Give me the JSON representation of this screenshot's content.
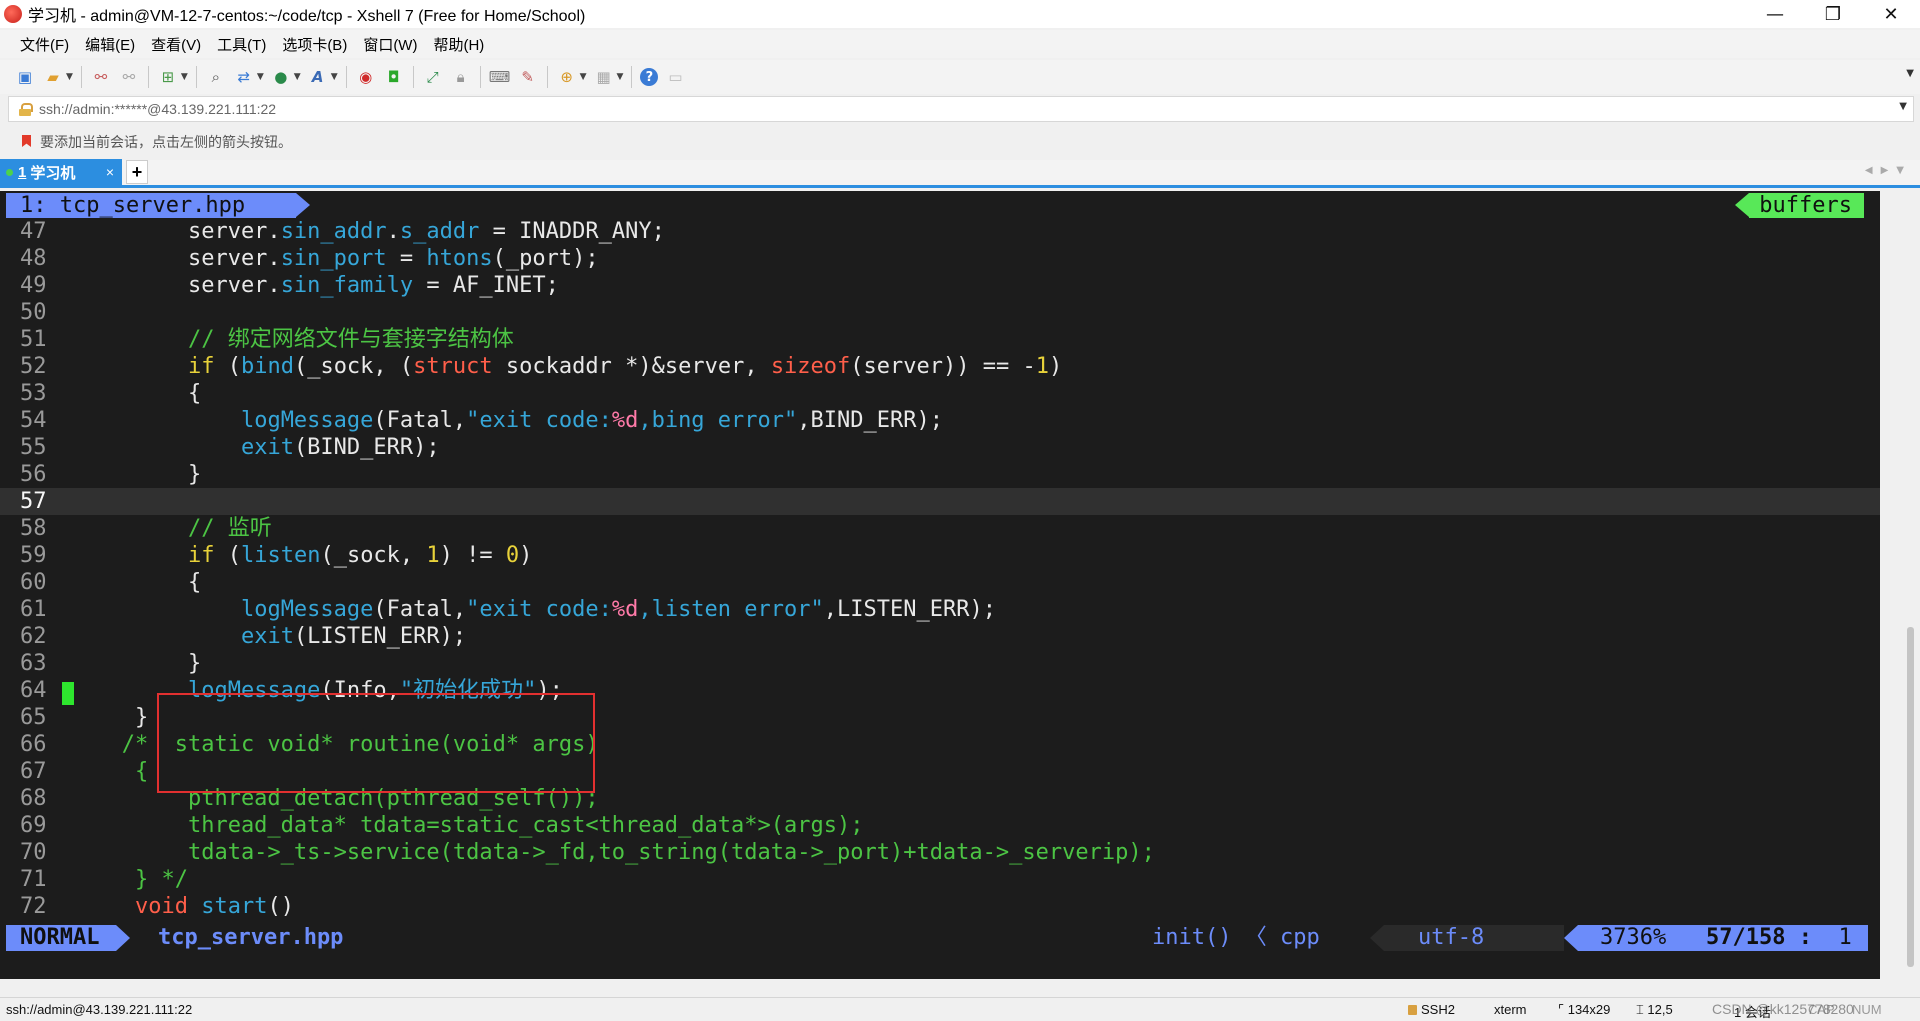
{
  "window": {
    "title": "学习机 - admin@VM-12-7-centos:~/code/tcp - Xshell 7 (Free for Home/School)",
    "minimize": "—",
    "restore": "❐",
    "close": "✕"
  },
  "menu": [
    "文件(F)",
    "编辑(E)",
    "查看(V)",
    "工具(T)",
    "选项卡(B)",
    "窗口(W)",
    "帮助(H)"
  ],
  "toolbar": {
    "icons": [
      "new-session-icon",
      "open-folder-icon",
      "disconnect-icon",
      "reconnect-icon",
      "new-tab-icon",
      "find-icon",
      "transfer-icon",
      "globe-icon",
      "font-icon",
      "xftp-icon",
      "xshell-icon",
      "fullscreen-icon",
      "lock-icon",
      "keyboard-icon",
      "script-icon",
      "compose-icon",
      "layout-icon",
      "help-icon",
      "chat-icon"
    ]
  },
  "address": {
    "value": "ssh://admin:******@43.139.221.111:22"
  },
  "hint": {
    "text": "要添加当前会话，点击左侧的箭头按钮。"
  },
  "tabs": [
    {
      "number": "1",
      "label": "学习机",
      "close": "×"
    }
  ],
  "tab_add": "+",
  "vim": {
    "buffer_title": "1: tcp_server.hpp",
    "buffers_label": "buffers",
    "mode": "NORMAL",
    "filename": "tcp_server.hpp",
    "function": "init() 〈 cpp",
    "encoding": "utf-8",
    "percent": "3736%",
    "position": "57/158",
    "column_sep": ":",
    "column": "1"
  },
  "code_lines": [
    {
      "n": "47",
      "segs": [
        [
          "        server.",
          "pl"
        ],
        [
          "sin_addr",
          "fld"
        ],
        [
          ".",
          "pl"
        ],
        [
          "s_addr",
          "fld"
        ],
        [
          " = INADDR_ANY;",
          "pl"
        ]
      ]
    },
    {
      "n": "48",
      "segs": [
        [
          "        server.",
          "pl"
        ],
        [
          "sin_port",
          "fld"
        ],
        [
          " = ",
          "pl"
        ],
        [
          "htons",
          "fn"
        ],
        [
          "(_port);",
          "pl"
        ]
      ]
    },
    {
      "n": "49",
      "segs": [
        [
          "        server.",
          "pl"
        ],
        [
          "sin_family",
          "fld"
        ],
        [
          " = AF_INET;",
          "pl"
        ]
      ]
    },
    {
      "n": "50",
      "segs": []
    },
    {
      "n": "51",
      "segs": [
        [
          "        // 绑定网络文件与套接字结构体",
          "cm"
        ]
      ]
    },
    {
      "n": "52",
      "segs": [
        [
          "        ",
          "pl"
        ],
        [
          "if",
          "kw"
        ],
        [
          " (",
          "pl"
        ],
        [
          "bind",
          "fn"
        ],
        [
          "(_sock, (",
          "pl"
        ],
        [
          "struct",
          "ty"
        ],
        [
          " sockaddr *)&server, ",
          "pl"
        ],
        [
          "sizeof",
          "ty"
        ],
        [
          "(server)) == -",
          "pl"
        ],
        [
          "1",
          "nm"
        ],
        [
          ")",
          "pl"
        ]
      ]
    },
    {
      "n": "53",
      "segs": [
        [
          "        {",
          "pl"
        ]
      ]
    },
    {
      "n": "54",
      "segs": [
        [
          "            ",
          "pl"
        ],
        [
          "logMessage",
          "fn"
        ],
        [
          "(Fatal,",
          "pl"
        ],
        [
          "\"exit code:",
          "st"
        ],
        [
          "%d",
          "fmt"
        ],
        [
          ",bing error\"",
          "st"
        ],
        [
          ",BIND_ERR);",
          "pl"
        ]
      ]
    },
    {
      "n": "55",
      "segs": [
        [
          "            ",
          "pl"
        ],
        [
          "exit",
          "fn"
        ],
        [
          "(BIND_ERR);",
          "pl"
        ]
      ]
    },
    {
      "n": "56",
      "segs": [
        [
          "        }",
          "pl"
        ]
      ]
    },
    {
      "n": "57",
      "segs": [],
      "current": true
    },
    {
      "n": "58",
      "segs": [
        [
          "        // 监听",
          "cm"
        ]
      ]
    },
    {
      "n": "59",
      "segs": [
        [
          "        ",
          "pl"
        ],
        [
          "if",
          "kw"
        ],
        [
          " (",
          "pl"
        ],
        [
          "listen",
          "fn"
        ],
        [
          "(_sock, ",
          "pl"
        ],
        [
          "1",
          "nm"
        ],
        [
          ") != ",
          "pl"
        ],
        [
          "0",
          "nm"
        ],
        [
          ")",
          "pl"
        ]
      ]
    },
    {
      "n": "60",
      "segs": [
        [
          "        {",
          "pl"
        ]
      ]
    },
    {
      "n": "61",
      "segs": [
        [
          "            ",
          "pl"
        ],
        [
          "logMessage",
          "fn"
        ],
        [
          "(Fatal,",
          "pl"
        ],
        [
          "\"exit code:",
          "st"
        ],
        [
          "%d",
          "fmt"
        ],
        [
          ",listen error\"",
          "st"
        ],
        [
          ",LISTEN_ERR);",
          "pl"
        ]
      ]
    },
    {
      "n": "62",
      "segs": [
        [
          "            ",
          "pl"
        ],
        [
          "exit",
          "fn"
        ],
        [
          "(LISTEN_ERR);",
          "pl"
        ]
      ]
    },
    {
      "n": "63",
      "segs": [
        [
          "        }",
          "pl"
        ]
      ]
    },
    {
      "n": "64",
      "segs": [
        [
          "        ",
          "pl"
        ],
        [
          "logMessage",
          "fn"
        ],
        [
          "(Info,",
          "pl"
        ],
        [
          "\"初始化成功\"",
          "st"
        ],
        [
          ");",
          "pl"
        ]
      ]
    },
    {
      "n": "65",
      "segs": [
        [
          "    }",
          "pl"
        ]
      ]
    },
    {
      "n": "66",
      "segs": [
        [
          "   /*  static void* routine(void* args)",
          "cm"
        ]
      ]
    },
    {
      "n": "67",
      "segs": [
        [
          "    {",
          "cm"
        ]
      ]
    },
    {
      "n": "68",
      "segs": [
        [
          "        pthread_detach(pthread_self());",
          "cm"
        ]
      ]
    },
    {
      "n": "69",
      "segs": [
        [
          "        thread_data* tdata=static_cast<thread_data*>(args);",
          "cm"
        ]
      ]
    },
    {
      "n": "70",
      "segs": [
        [
          "        tdata->_ts->service(tdata->_fd,to_string(tdata->_port)+tdata->_serverip);",
          "cm"
        ]
      ]
    },
    {
      "n": "71",
      "segs": [
        [
          "    } */",
          "cm"
        ]
      ]
    },
    {
      "n": "72",
      "segs": [
        [
          "    ",
          "pl"
        ],
        [
          "void",
          "ty"
        ],
        [
          " ",
          "pl"
        ],
        [
          "start",
          "fn"
        ],
        [
          "()",
          "pl"
        ]
      ]
    }
  ],
  "statusbar": {
    "connection": "ssh://admin@43.139.221.111:22",
    "protocol": "SSH2",
    "terminal": "xterm",
    "size": "134x29",
    "cursor": "12,5",
    "sessions": "1 会话",
    "caps": "CAP",
    "num": "NUM",
    "watermark": "CSDN @kk125778280"
  },
  "colors": {
    "terminal_bg": "#1c1c1c",
    "accent": "#2c8ee0",
    "vim_blue": "#6c8cfa",
    "vim_green": "#58e858",
    "highlight_box": "#e23030"
  }
}
